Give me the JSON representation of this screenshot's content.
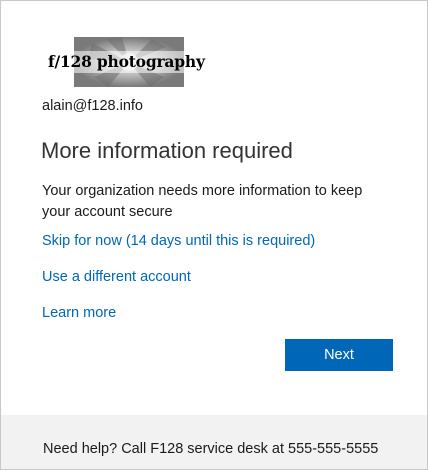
{
  "brand": {
    "logo_text": "f/128 photography",
    "logo_icon": "camera-aperture-icon"
  },
  "account": {
    "email": "alain@f128.info"
  },
  "main": {
    "title": "More information required",
    "description": "Your organization needs more information to keep your account secure",
    "skip_link": "Skip for now (14 days until this is required)",
    "other_account_link": "Use a different account",
    "learn_more_link": "Learn more",
    "next_label": "Next"
  },
  "footer": {
    "help_text": "Need help? Call F128 service desk at 555-555-5555"
  },
  "colors": {
    "accent": "#0067b8",
    "footer_bg": "#f2f2f2",
    "text": "#1b1b1b"
  }
}
